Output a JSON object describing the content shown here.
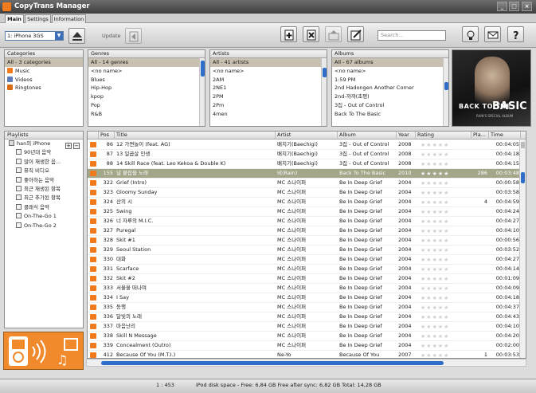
{
  "app": {
    "title": "CopyTrans Manager"
  },
  "tabs": [
    {
      "label": "Main"
    },
    {
      "label": "Settings"
    },
    {
      "label": "Information"
    }
  ],
  "toolbar": {
    "device": "1: iPhone 3GS",
    "update_label": "Update",
    "search_placeholder": "Search..."
  },
  "categories": {
    "header": "Categories",
    "items": [
      "All - 3 categories",
      "Music",
      "Videos",
      "Ringtones"
    ]
  },
  "genres": {
    "header": "Genres",
    "items": [
      "All - 14 genres",
      "<no name>",
      "Blues",
      "Hip-Hop",
      "kpop",
      "Pop",
      "R&B"
    ]
  },
  "artists": {
    "header": "Artists",
    "items": [
      "All - 41 artists",
      "<no name>",
      "2AM",
      "2NE1",
      "2PM",
      "2Pm",
      "4men"
    ]
  },
  "albums": {
    "header": "Albums",
    "items": [
      "All - 67 albums",
      "<no name>",
      "1:59 PM",
      "2nd Hadongen Another Corner",
      "2nd-까까(초평)",
      "3집 - Out of Control",
      "Back To The Basic"
    ]
  },
  "album_art": {
    "line1": "BACK TO THE",
    "line2": "BASIC",
    "subtitle": "RAIN'S SPECIAL ALBUM"
  },
  "playlists": {
    "header": "Playlists",
    "items": [
      "han의 iPhone",
      "90년대 음악",
      "많이 재생한 음...",
      "뮤직 비디오",
      "좋아하는 음악",
      "최근 재생된 항목",
      "최근 추가된 항목",
      "클래식 음악",
      "On-The-Go 1",
      "On-The-Go 2"
    ]
  },
  "songs": {
    "columns": [
      "Pos",
      "Title",
      "Artist",
      "Album",
      "Year",
      "Rating",
      "Pla...",
      "Time"
    ],
    "rows": [
      {
        "pos": "86",
        "title": "12 가면놀이 (feat. AG)",
        "artist": "배치기(Baechigi)",
        "album": "3집 - Out of Control",
        "year": "2008",
        "plays": "",
        "time": "00:04:05"
      },
      {
        "pos": "87",
        "title": "13 일곱살 인생",
        "artist": "배치기(Baechigi)",
        "album": "3집 - Out of Control",
        "year": "2008",
        "plays": "",
        "time": "00:04:18"
      },
      {
        "pos": "88",
        "title": "14 Skill Race (feat. Leo Kekoa & Double K)",
        "artist": "배치기(Baechigi)",
        "album": "3집 - Out of Control",
        "year": "2008",
        "plays": "",
        "time": "00:04:15"
      },
      {
        "pos": "155",
        "title": "널 붙잡을 노래",
        "artist": "비(Rain)",
        "album": "Back To The Basic",
        "year": "2010",
        "plays": "286",
        "time": "00:03:48",
        "selected": true
      },
      {
        "pos": "322",
        "title": "Grief (Intro)",
        "artist": "MC 스나이퍼",
        "album": "Be In Deep Grief",
        "year": "2004",
        "plays": "",
        "time": "00:00:58"
      },
      {
        "pos": "323",
        "title": "Gloomy Sunday",
        "artist": "MC 스나이퍼",
        "album": "Be In Deep Grief",
        "year": "2004",
        "plays": "",
        "time": "00:03:58"
      },
      {
        "pos": "324",
        "title": "산의 시",
        "artist": "MC 스나이퍼",
        "album": "Be In Deep Grief",
        "year": "2004",
        "plays": "4",
        "time": "00:04:59"
      },
      {
        "pos": "325",
        "title": "Swing",
        "artist": "MC 스나이퍼",
        "album": "Be In Deep Grief",
        "year": "2004",
        "plays": "",
        "time": "00:04:24"
      },
      {
        "pos": "326",
        "title": "너 자루의 M.I.C.",
        "artist": "MC 스나이퍼",
        "album": "Be In Deep Grief",
        "year": "2004",
        "plays": "",
        "time": "00:04:27"
      },
      {
        "pos": "327",
        "title": "Puregal",
        "artist": "MC 스나이퍼",
        "album": "Be In Deep Grief",
        "year": "2004",
        "plays": "",
        "time": "00:04:10"
      },
      {
        "pos": "328",
        "title": "Skit #1",
        "artist": "MC 스나이퍼",
        "album": "Be In Deep Grief",
        "year": "2004",
        "plays": "",
        "time": "00:00:56"
      },
      {
        "pos": "329",
        "title": "Seoul Station",
        "artist": "MC 스나이퍼",
        "album": "Be In Deep Grief",
        "year": "2004",
        "plays": "",
        "time": "00:03:52"
      },
      {
        "pos": "330",
        "title": "대화",
        "artist": "MC 스나이퍼",
        "album": "Be In Deep Grief",
        "year": "2004",
        "plays": "",
        "time": "00:04:27"
      },
      {
        "pos": "331",
        "title": "Scarface",
        "artist": "MC 스나이퍼",
        "album": "Be In Deep Grief",
        "year": "2004",
        "plays": "",
        "time": "00:04:14"
      },
      {
        "pos": "332",
        "title": "Skit #2",
        "artist": "MC 스나이퍼",
        "album": "Be In Deep Grief",
        "year": "2004",
        "plays": "",
        "time": "00:01:09"
      },
      {
        "pos": "333",
        "title": "서울을 떠나며",
        "artist": "MC 스나이퍼",
        "album": "Be In Deep Grief",
        "year": "2004",
        "plays": "",
        "time": "00:04:09"
      },
      {
        "pos": "334",
        "title": "I Say",
        "artist": "MC 스나이퍼",
        "album": "Be In Deep Grief",
        "year": "2004",
        "plays": "",
        "time": "00:04:18"
      },
      {
        "pos": "335",
        "title": "동행",
        "artist": "MC 스나이퍼",
        "album": "Be In Deep Grief",
        "year": "2004",
        "plays": "",
        "time": "00:04:37"
      },
      {
        "pos": "336",
        "title": "달빛의 노래",
        "artist": "MC 스나이퍼",
        "album": "Be In Deep Grief",
        "year": "2004",
        "plays": "",
        "time": "00:04:43"
      },
      {
        "pos": "337",
        "title": "마음난리",
        "artist": "MC 스나이퍼",
        "album": "Be In Deep Grief",
        "year": "2004",
        "plays": "",
        "time": "00:04:10"
      },
      {
        "pos": "338",
        "title": "Skill N Message",
        "artist": "MC 스나이퍼",
        "album": "Be In Deep Grief",
        "year": "2004",
        "plays": "",
        "time": "00:04:20"
      },
      {
        "pos": "339",
        "title": "Concealment (Outro)",
        "artist": "MC 스나이퍼",
        "album": "Be In Deep Grief",
        "year": "2004",
        "plays": "",
        "time": "00:02:00"
      },
      {
        "pos": "412",
        "title": "Because Of You (M.T.I.)",
        "artist": "Ne-Yo",
        "album": "Because Of You",
        "year": "2007",
        "plays": "1",
        "time": "00:03:53"
      }
    ]
  },
  "status": {
    "position": "1 : 453",
    "disk": "iPod disk space - Free: 6,84 GB Free after sync: 6,82 GB Total: 14,28 GB"
  },
  "colors": {
    "accent_orange": "#f07a1c",
    "selection_olive": "#a4a68a",
    "scroll_blue": "#2f6ec9"
  }
}
